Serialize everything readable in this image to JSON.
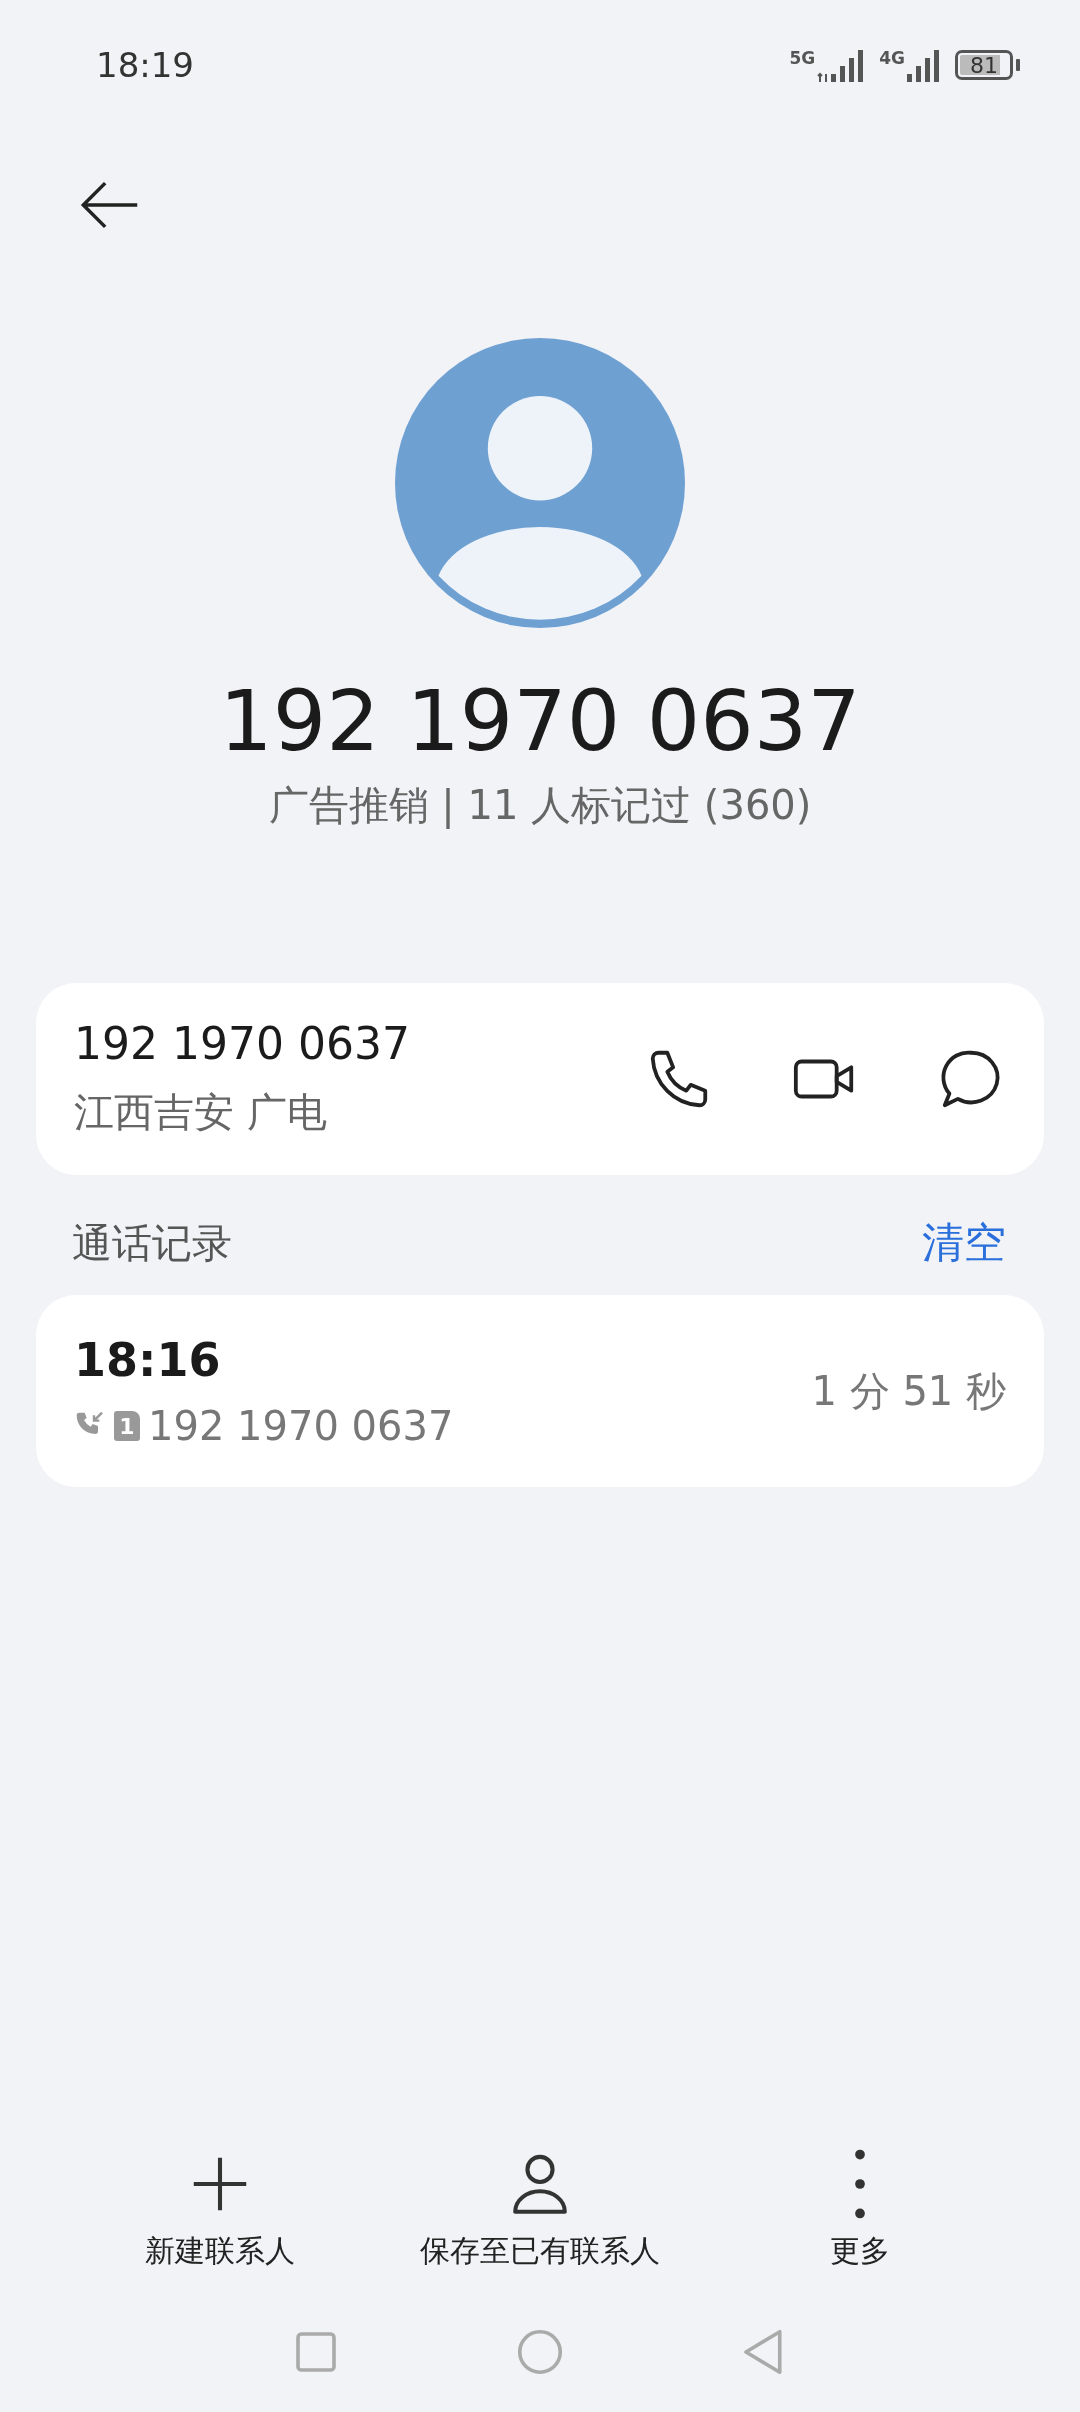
{
  "status_bar": {
    "time": "18:19",
    "networks": [
      {
        "label": "5G"
      },
      {
        "label": "4G"
      }
    ],
    "battery": "81"
  },
  "contact": {
    "number": "192 1970 0637",
    "tag_line": "广告推销 | 11 人标记过 (360)"
  },
  "number_card": {
    "number": "192 1970 0637",
    "location": "江西吉安 广电",
    "actions": [
      {
        "kind": "call"
      },
      {
        "kind": "video"
      },
      {
        "kind": "message"
      }
    ]
  },
  "call_log": {
    "title": "通话记录",
    "clear": "清空",
    "entries": [
      {
        "time": "18:16",
        "sim": "1",
        "number": "192 1970 0637",
        "duration": "1 分 51 秒"
      }
    ]
  },
  "bottom_actions": [
    {
      "kind": "add",
      "label": "新建联系人"
    },
    {
      "kind": "person",
      "label": "保存至已有联系人"
    },
    {
      "kind": "more",
      "label": "更多"
    }
  ]
}
